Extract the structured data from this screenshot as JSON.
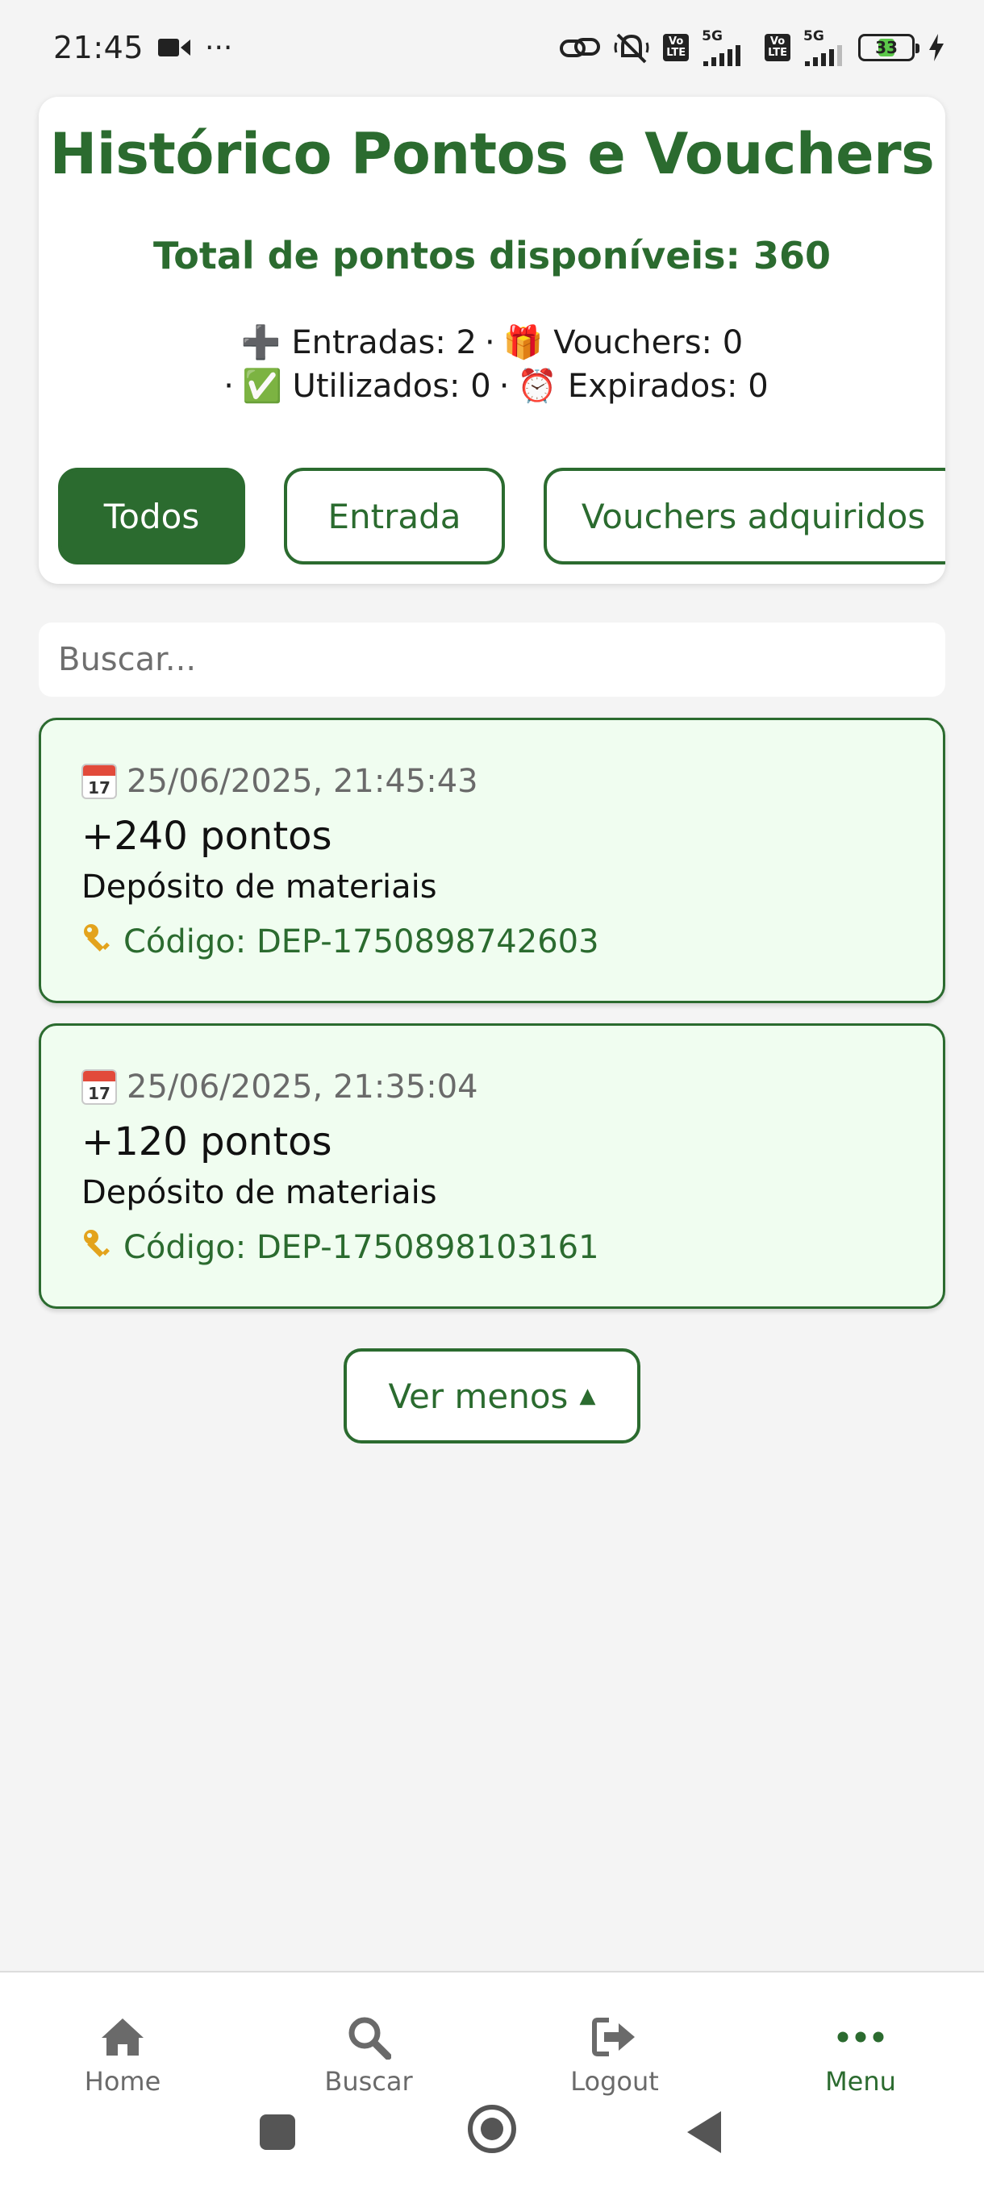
{
  "status_bar": {
    "time": "21:45",
    "dots": "···",
    "sig1_label": "5G",
    "sig2_label": "5G",
    "volte_label": "Vo\nLTE",
    "battery_level": "33",
    "battery_fraction": 0.33
  },
  "header": {
    "title": "Histórico Pontos e Vouchers",
    "total_label": "Total de pontos disponíveis: 360",
    "stats": {
      "entradas": "➕ Entradas: 2",
      "vouchers": "🎁 Vouchers: 0",
      "utilizados": "✅ Utilizados: 0",
      "expirados": "⏰ Expirados: 0",
      "separator": "·"
    },
    "filters": {
      "todos": "Todos",
      "entrada": "Entrada",
      "vouchers": "Vouchers adquiridos"
    }
  },
  "search": {
    "placeholder": "Buscar..."
  },
  "entries": [
    {
      "date": "25/06/2025, 21:45:43",
      "points": "+240 pontos",
      "description": "Depósito de materiais",
      "code": "Código: DEP-1750898742603"
    },
    {
      "date": "25/06/2025, 21:35:04",
      "points": "+120 pontos",
      "description": "Depósito de materiais",
      "code": "Código: DEP-1750898103161"
    }
  ],
  "calendar_icon_day": "17",
  "ver_menos": {
    "label": "Ver menos",
    "arrow": "▲"
  },
  "bottom_nav": {
    "home": "Home",
    "buscar": "Buscar",
    "logout": "Logout",
    "menu": "Menu"
  },
  "colors": {
    "primary": "#2b6b2f",
    "card_bg": "#f0fdf0",
    "page_bg": "#f4f4f4"
  }
}
